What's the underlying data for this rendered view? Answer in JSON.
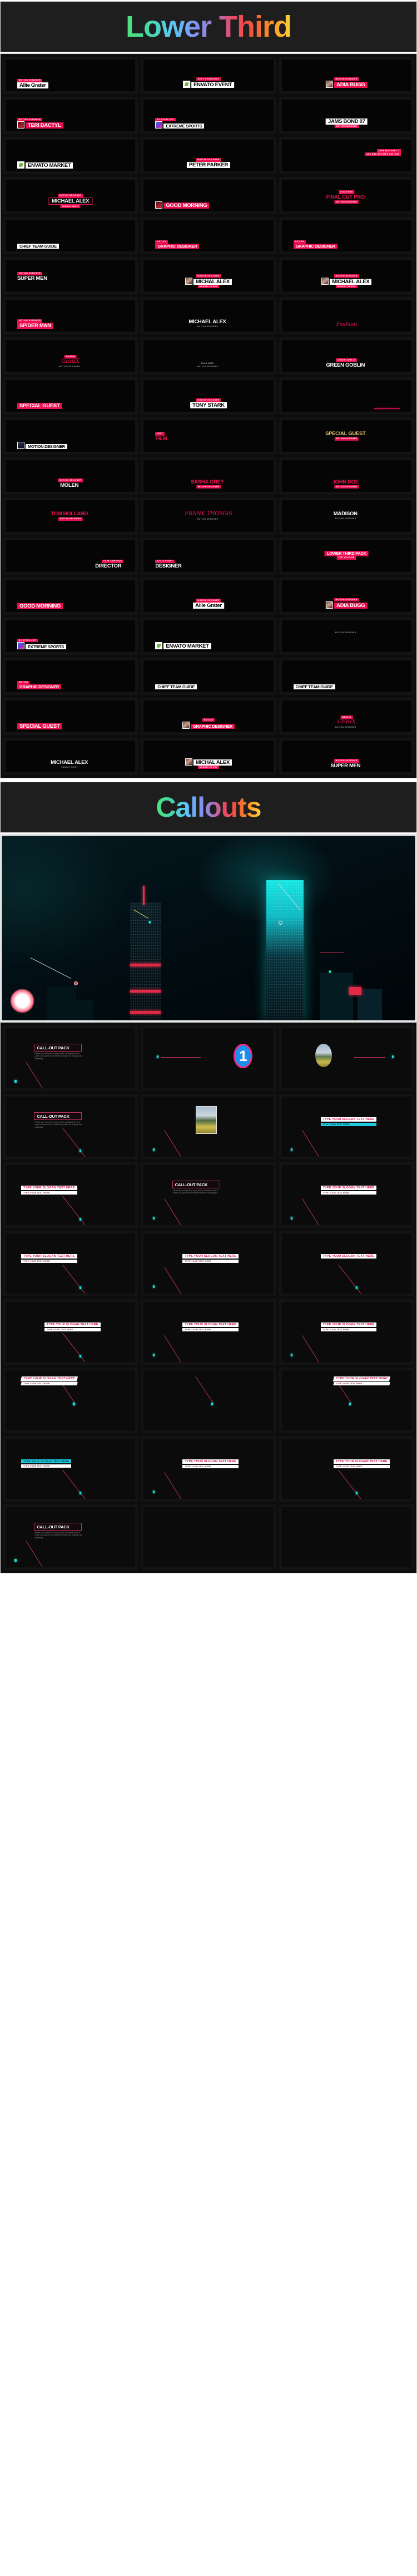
{
  "sections": [
    {
      "id": "lower-third",
      "title": "Lower Third"
    },
    {
      "id": "callouts",
      "title": "Callouts"
    }
  ],
  "lower_third": {
    "title": "Lower Third",
    "tiles": [
      {
        "kicker": "MOTION DESIGNER",
        "name": "Allie Grater",
        "sub": "",
        "style": "white-bar",
        "pos": "pos-bl",
        "thumb": ""
      },
      {
        "kicker": "BEST WEDNESDAY",
        "name": "ENVATO EVENT",
        "sub": "",
        "style": "white-bar",
        "pos": "pos-bc",
        "thumb": "logo"
      },
      {
        "kicker": "MOTION DESIGNER",
        "name": "ADIA BUGG",
        "sub": "",
        "style": "red-bar",
        "pos": "pos-bc",
        "thumb": "portrait"
      },
      {
        "kicker": "MOTION DESIGNER",
        "name": "TERI DACTYL",
        "sub": "",
        "style": "red-bar",
        "pos": "pos-bl",
        "thumb": "red"
      },
      {
        "kicker": "BY STORY ART",
        "name": "EXTREME SPORTS",
        "sub": "",
        "style": "white-bar",
        "pos": "pos-bl",
        "thumb": "blue"
      },
      {
        "kicker": "",
        "name": "JAMS BOND 07",
        "sub": "MOTION DESIGNER",
        "style": "white-bar",
        "pos": "pos-bc",
        "thumb": ""
      },
      {
        "kicker": "",
        "name": "ENVATO MARKET",
        "sub": "",
        "style": "white-bar",
        "pos": "pos-bl",
        "thumb": "logo"
      },
      {
        "kicker": "MOTION DESIGNER",
        "name": "PETER PARKER",
        "sub": "",
        "style": "white-bar",
        "pos": "pos-bc",
        "thumb": ""
      },
      {
        "kicker": "IRON MAN PART 4",
        "name": "",
        "sub": "AND WAR ARCHERS AND GOD",
        "style": "white-bar",
        "pos": "pos-mr",
        "thumb": "red"
      },
      {
        "kicker": "MOTION DESIGNER",
        "name": "MICHAEL ALEX",
        "sub": "SUNDAY NIGHT",
        "style": "outline",
        "pos": "pos-bc",
        "thumb": ""
      },
      {
        "kicker": "",
        "name": "GOOD MORNING",
        "sub": "",
        "style": "red-bar",
        "pos": "pos-bl",
        "thumb": "red"
      },
      {
        "kicker": "GOOD FOR",
        "name": "FINAL CUT PRO",
        "sub": "MOTION DESIGNER",
        "style": "red-text",
        "pos": "pos-mc",
        "thumb": ""
      },
      {
        "kicker": "",
        "name": "CHIEF TEAM GUIDE",
        "sub": "",
        "style": "white-bar",
        "pos": "pos-bl",
        "thumb": ""
      },
      {
        "kicker": "MOTION",
        "name": "GRAPHIC DESIGNER",
        "sub": "",
        "style": "red-bar",
        "pos": "pos-bl",
        "thumb": ""
      },
      {
        "kicker": "MOTION",
        "name": "GRAPHIC DESIGNER",
        "sub": "",
        "style": "red-bar",
        "pos": "pos-bl",
        "thumb": ""
      },
      {
        "kicker": "MOTION DESIGNER",
        "name": "SUPER MEN",
        "sub": "",
        "style": "invert",
        "pos": "pos-ml",
        "thumb": ""
      },
      {
        "kicker": "MOTION DESIGNER",
        "name": "MICHAL ALEX",
        "sub": "MONDAY 28 NOV",
        "style": "white-bar",
        "pos": "pos-bc",
        "thumb": "portrait"
      },
      {
        "kicker": "MOTION DESIGNER",
        "name": "MICHAEL ALEX",
        "sub": "MONDAY 28 NOV",
        "style": "white-bar",
        "pos": "pos-bc",
        "thumb": "portrait"
      },
      {
        "kicker": "MOTION DESIGNER",
        "name": "SPIDER MAN",
        "sub": "",
        "style": "red-bar",
        "pos": "pos-bl",
        "thumb": ""
      },
      {
        "kicker": "",
        "name": "MICHAEL ALEX",
        "sub": "MOTION DESIGNER",
        "style": "invert",
        "pos": "pos-bc",
        "thumb": ""
      },
      {
        "kicker": "",
        "name": "Fashion",
        "sub": "",
        "style": "script",
        "pos": "pos-bc",
        "thumb": ""
      },
      {
        "kicker": "MARTIN",
        "name": "GERIX",
        "sub": "MOTION DESIGNER",
        "style": "script",
        "pos": "pos-bc",
        "thumb": ""
      },
      {
        "kicker": "JHON WICK",
        "name": "",
        "sub": "MOTION DESIGNER",
        "style": "plain",
        "pos": "pos-bc",
        "thumb": ""
      },
      {
        "kicker": "GREEN GOBLIN",
        "name": "GREEN GOBLIN",
        "sub": "",
        "style": "invert",
        "pos": "pos-bc",
        "thumb": ""
      },
      {
        "kicker": "",
        "name": "SPECIAL GUEST",
        "sub": "",
        "style": "red-bar",
        "pos": "pos-bl",
        "thumb": ""
      },
      {
        "kicker": "MOTION DESIGNER",
        "name": "TONY STARK",
        "sub": "",
        "style": "white-bar",
        "pos": "pos-bc",
        "thumb": ""
      },
      {
        "kicker": "",
        "name": "",
        "sub": "",
        "style": "line-only",
        "pos": "pos-br",
        "thumb": ""
      },
      {
        "kicker": "",
        "name": "MOTION DESIGNER",
        "sub": "",
        "style": "white-bar",
        "pos": "pos-bl",
        "thumb": "dark"
      },
      {
        "kicker": "NEXT",
        "name": "FILM",
        "sub": "",
        "style": "red-text",
        "pos": "pos-ml",
        "thumb": ""
      },
      {
        "kicker": "",
        "name": "SPECIAL GUEST",
        "sub": "MOTION DESIGNER",
        "style": "gold",
        "pos": "pos-mc",
        "thumb": ""
      },
      {
        "kicker": "MOTION DESIGNER",
        "name": "MOLEN",
        "sub": "",
        "style": "invert",
        "pos": "pos-bc",
        "thumb": ""
      },
      {
        "kicker": "",
        "name": "SASHA GREY",
        "sub": "MOTION DESIGNER",
        "style": "red-text",
        "pos": "pos-bc",
        "thumb": ""
      },
      {
        "kicker": "",
        "name": "JOHN DOE",
        "sub": "MOTION DESIGNER",
        "style": "red-text",
        "pos": "pos-bc",
        "thumb": ""
      },
      {
        "kicker": "",
        "name": "TOM HOLLAND",
        "sub": "MOTION DESIGNER",
        "style": "red-text",
        "pos": "pos-mc",
        "thumb": ""
      },
      {
        "kicker": "",
        "name": "FRANK THOMAS",
        "sub": "MOTION DESIGNER",
        "style": "script",
        "pos": "pos-mc",
        "thumb": ""
      },
      {
        "kicker": "",
        "name": "MADISON",
        "sub": "MOTION DESIGNER",
        "style": "invert",
        "pos": "pos-mc",
        "thumb": ""
      },
      {
        "kicker": "DAVE CAMERON",
        "name": "DIRECTOR",
        "sub": "",
        "style": "invert",
        "pos": "pos-br",
        "thumb": ""
      },
      {
        "kicker": "KATTY PERRY",
        "name": "DESIGNER",
        "sub": "",
        "style": "invert",
        "pos": "pos-bl",
        "thumb": ""
      },
      {
        "kicker": "",
        "name": "LOWER THIRD PACK",
        "sub": "FOR YOUTUBE",
        "style": "red-bar",
        "pos": "pos-mc",
        "thumb": ""
      },
      {
        "kicker": "",
        "name": "GOOD MORNING",
        "sub": "",
        "style": "red-bar",
        "pos": "pos-bl",
        "thumb": ""
      },
      {
        "kicker": "MOTION DESIGNER",
        "name": "Allie Grater",
        "sub": "",
        "style": "white-bar",
        "pos": "pos-bc",
        "thumb": ""
      },
      {
        "kicker": "MOTION DESIGNER",
        "name": "ADIA BUGG",
        "sub": "",
        "style": "red-bar",
        "pos": "pos-bc",
        "thumb": "portrait"
      },
      {
        "kicker": "BY STORY ART",
        "name": "EXTREME SPORTS",
        "sub": "",
        "style": "white-bar",
        "pos": "pos-bl",
        "thumb": "blue"
      },
      {
        "kicker": "",
        "name": "ENVATO MARKET",
        "sub": "",
        "style": "white-bar",
        "pos": "pos-bl",
        "thumb": "logo"
      },
      {
        "kicker": "",
        "name": "",
        "sub": "MOTION DESIGNER",
        "style": "plain",
        "pos": "pos-mc",
        "thumb": ""
      },
      {
        "kicker": "MOTION",
        "name": "GRAPHIC DESIGNER",
        "sub": "",
        "style": "red-bar",
        "pos": "pos-bl",
        "thumb": ""
      },
      {
        "kicker": "",
        "name": "CHIEF TEAM GUIDE",
        "sub": "",
        "style": "white-bar",
        "pos": "pos-bl",
        "thumb": ""
      },
      {
        "kicker": "",
        "name": "CHIEF TEAM GUIDE",
        "sub": "",
        "style": "white-bar",
        "pos": "pos-bl",
        "thumb": ""
      },
      {
        "kicker": "",
        "name": "SPECIAL GUEST",
        "sub": "",
        "style": "red-bar",
        "pos": "pos-bl",
        "thumb": ""
      },
      {
        "kicker": "MOTION",
        "name": "GRAPHIC DESIGNER",
        "sub": "",
        "style": "red-bar",
        "pos": "pos-bc",
        "thumb": "portrait"
      },
      {
        "kicker": "MARTIN",
        "name": "GERIX",
        "sub": "MOTION DESIGNER",
        "style": "script",
        "pos": "pos-bc",
        "thumb": ""
      },
      {
        "kicker": "",
        "name": "MICHAEL ALEX",
        "sub": "SUNDAY NIGHT",
        "style": "invert",
        "pos": "pos-bc",
        "thumb": ""
      },
      {
        "kicker": "",
        "name": "MICHAL ALEX",
        "sub": "MONDAY 28 NOV",
        "style": "white-bar",
        "pos": "pos-bc",
        "thumb": "portrait"
      },
      {
        "kicker": "MOTION DESIGNER",
        "name": "SUPER MEN",
        "sub": "",
        "style": "invert",
        "pos": "pos-bc",
        "thumb": ""
      }
    ]
  },
  "callouts": {
    "title": "Callouts",
    "hero": {
      "name": "night-city-skyline",
      "description": "Neon night city skyline with teal and red lit towers"
    },
    "tiles": [
      {
        "type": "title-body",
        "title": "CALL-OUT PACK",
        "body": "Perfect use of any sort of copy, select a business in that a career can approve your efficient operation will magnify it as effortlessly.",
        "line": "down-left",
        "pos": "mid"
      },
      {
        "type": "number",
        "number": "1",
        "line": "left",
        "pos": "mid"
      },
      {
        "type": "oval-photo",
        "line": "right",
        "pos": "mid"
      },
      {
        "type": "title-body",
        "title": "CALL-OUT PACK",
        "body": "Perfect use of any sort of copy, select a business in that a career can approve your efficient operation will magnify it as effortlessly.",
        "line": "down-right",
        "pos": "mid"
      },
      {
        "type": "photo",
        "line": "down-left",
        "pos": "mid"
      },
      {
        "type": "slogan",
        "slogan": "TYPE YOUR SLOGAN TEXT HERE",
        "sub": "TYPE YOUR TEXT HERE",
        "sub_style": "cyan",
        "line": "down-left",
        "pos": "mid"
      },
      {
        "type": "slogan",
        "slogan": "TYPE YOUR SLOGAN TEXT HERE",
        "sub": "TYPE YOUR TEXT HERE",
        "sub_style": "white",
        "line": "down-right",
        "pos": "left"
      },
      {
        "type": "title-body",
        "title": "CALL-OUT PACK",
        "body": "Perfect use of any sort of copy, select a business in that a career can approve your efficient operation will magnify it.",
        "line": "down-left",
        "pos": "mid"
      },
      {
        "type": "slogan",
        "slogan": "TYPE YOUR SLOGAN TEXT HERE",
        "sub": "TYPE YOUR TEXT HERE",
        "sub_style": "white",
        "line": "down-left",
        "pos": "mid"
      },
      {
        "type": "slogan",
        "slogan": "TYPE YOUR SLOGAN TEXT HERE",
        "sub": "TYPE YOUR TEXT HERE",
        "sub_style": "white",
        "line": "down-right",
        "pos": "left"
      },
      {
        "type": "slogan",
        "slogan": "TYPE YOUR SLOGAN TEXT HERE",
        "sub": "TYPE YOUR TEXT HERE",
        "sub_style": "white",
        "line": "down-left",
        "pos": "mid"
      },
      {
        "type": "slogan",
        "slogan": "TYPE YOUR SLOGAN TEXT HERE",
        "sub": "",
        "sub_style": "white",
        "line": "down-right",
        "pos": "mid"
      },
      {
        "type": "slogan",
        "slogan": "TYPE YOUR SLOGAN TEXT HERE",
        "sub": "TYPE YOUR TEXT HERE",
        "sub_style": "white",
        "line": "down-right",
        "pos": "mid"
      },
      {
        "type": "slogan",
        "slogan": "TYPE YOUR SLOGAN TEXT HERE",
        "sub": "TYPE YOUR TEXT HERE",
        "sub_style": "white",
        "line": "down-left",
        "pos": "mid"
      },
      {
        "type": "slogan",
        "slogan": "TYPE YOUR SLOGAN TEXT HERE",
        "sub": "TYPE YOUR TEXT HERE",
        "sub_style": "white",
        "line": "down-left",
        "pos": "mid"
      },
      {
        "type": "bars",
        "slogan": "TYPE YOUR SLOGAN TEXT HERE",
        "sub": "TYPE YOUR TEXT HERE",
        "sub_style": "white",
        "line": "up-right",
        "pos": "left"
      },
      {
        "type": "line-only",
        "line": "up-right",
        "pos": "mid"
      },
      {
        "type": "bars",
        "slogan": "TYPE YOUR SLOGAN TEXT HERE",
        "sub": "TYPE YOUR TEXT HERE",
        "sub_style": "white",
        "line": "up-right",
        "pos": "right"
      },
      {
        "type": "slogan",
        "slogan": "TYPE YOUR SLOGAN TEXT HERE",
        "sub": "TYPE YOUR TEXT HERE",
        "sub_style": "cyan-top",
        "line": "down-right",
        "pos": "left"
      },
      {
        "type": "slogan",
        "slogan": "TYPE YOUR SLOGAN TEXT HERE",
        "sub": "TYPE YOUR TEXT HERE",
        "sub_style": "white",
        "line": "down-left",
        "pos": "mid"
      },
      {
        "type": "slogan",
        "slogan": "TYPE YOUR SLOGAN TEXT HERE",
        "sub": "TYPE YOUR TEXT HERE",
        "sub_style": "white",
        "line": "down-right",
        "pos": "right"
      },
      {
        "type": "title-body",
        "title": "CALL-OUT PACK",
        "body": "Perfect use of any sort of copy, select a business in that a career can approve your efficient operation will magnify it as effortlessly.",
        "line": "down-left",
        "pos": "mid"
      },
      {
        "type": "empty"
      },
      {
        "type": "empty"
      }
    ]
  }
}
